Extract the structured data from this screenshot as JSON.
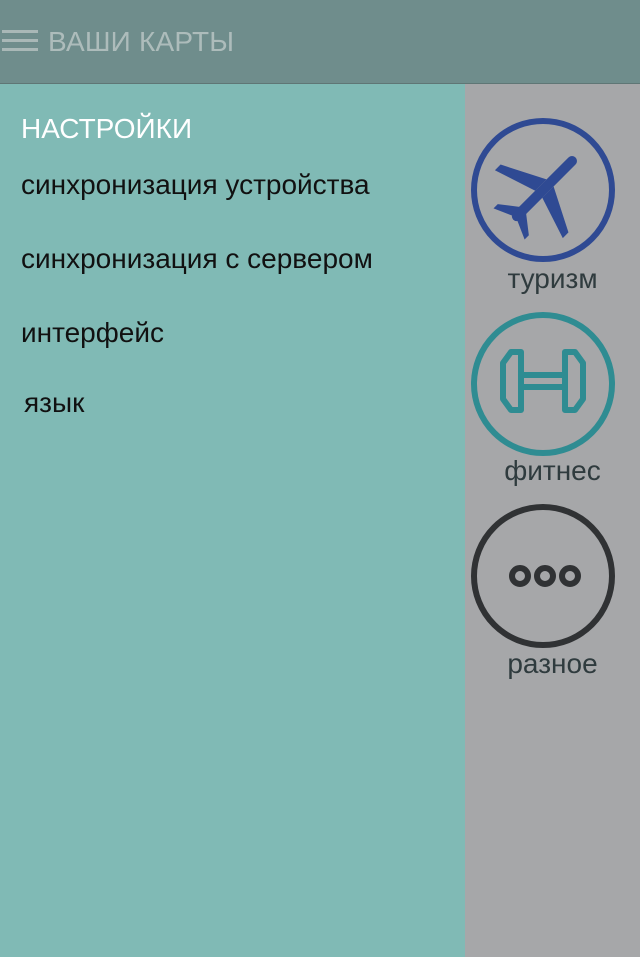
{
  "header": {
    "title": "ВАШИ КАРТЫ",
    "menu_icon": "hamburger-icon"
  },
  "menu": {
    "heading": "НАСТРОЙКИ",
    "items": [
      {
        "label": "синхронизация устройства"
      },
      {
        "label": "синхронизация с сервером"
      },
      {
        "label": "интерфейс"
      },
      {
        "label": "язык"
      }
    ]
  },
  "categories": [
    {
      "label": "туризм",
      "icon": "airplane-icon",
      "color": "#2f4a93"
    },
    {
      "label": "фитнес",
      "icon": "dumbbell-icon",
      "color": "#2f8c92"
    },
    {
      "label": "разное",
      "icon": "more-dots-icon",
      "color": "#303234"
    }
  ],
  "colors": {
    "header_bg": "#6f8d8c",
    "menu_bg": "#80bab5",
    "rail_bg": "#a6a7a9",
    "heading_text": "#ffffff",
    "menu_text": "#111111"
  }
}
